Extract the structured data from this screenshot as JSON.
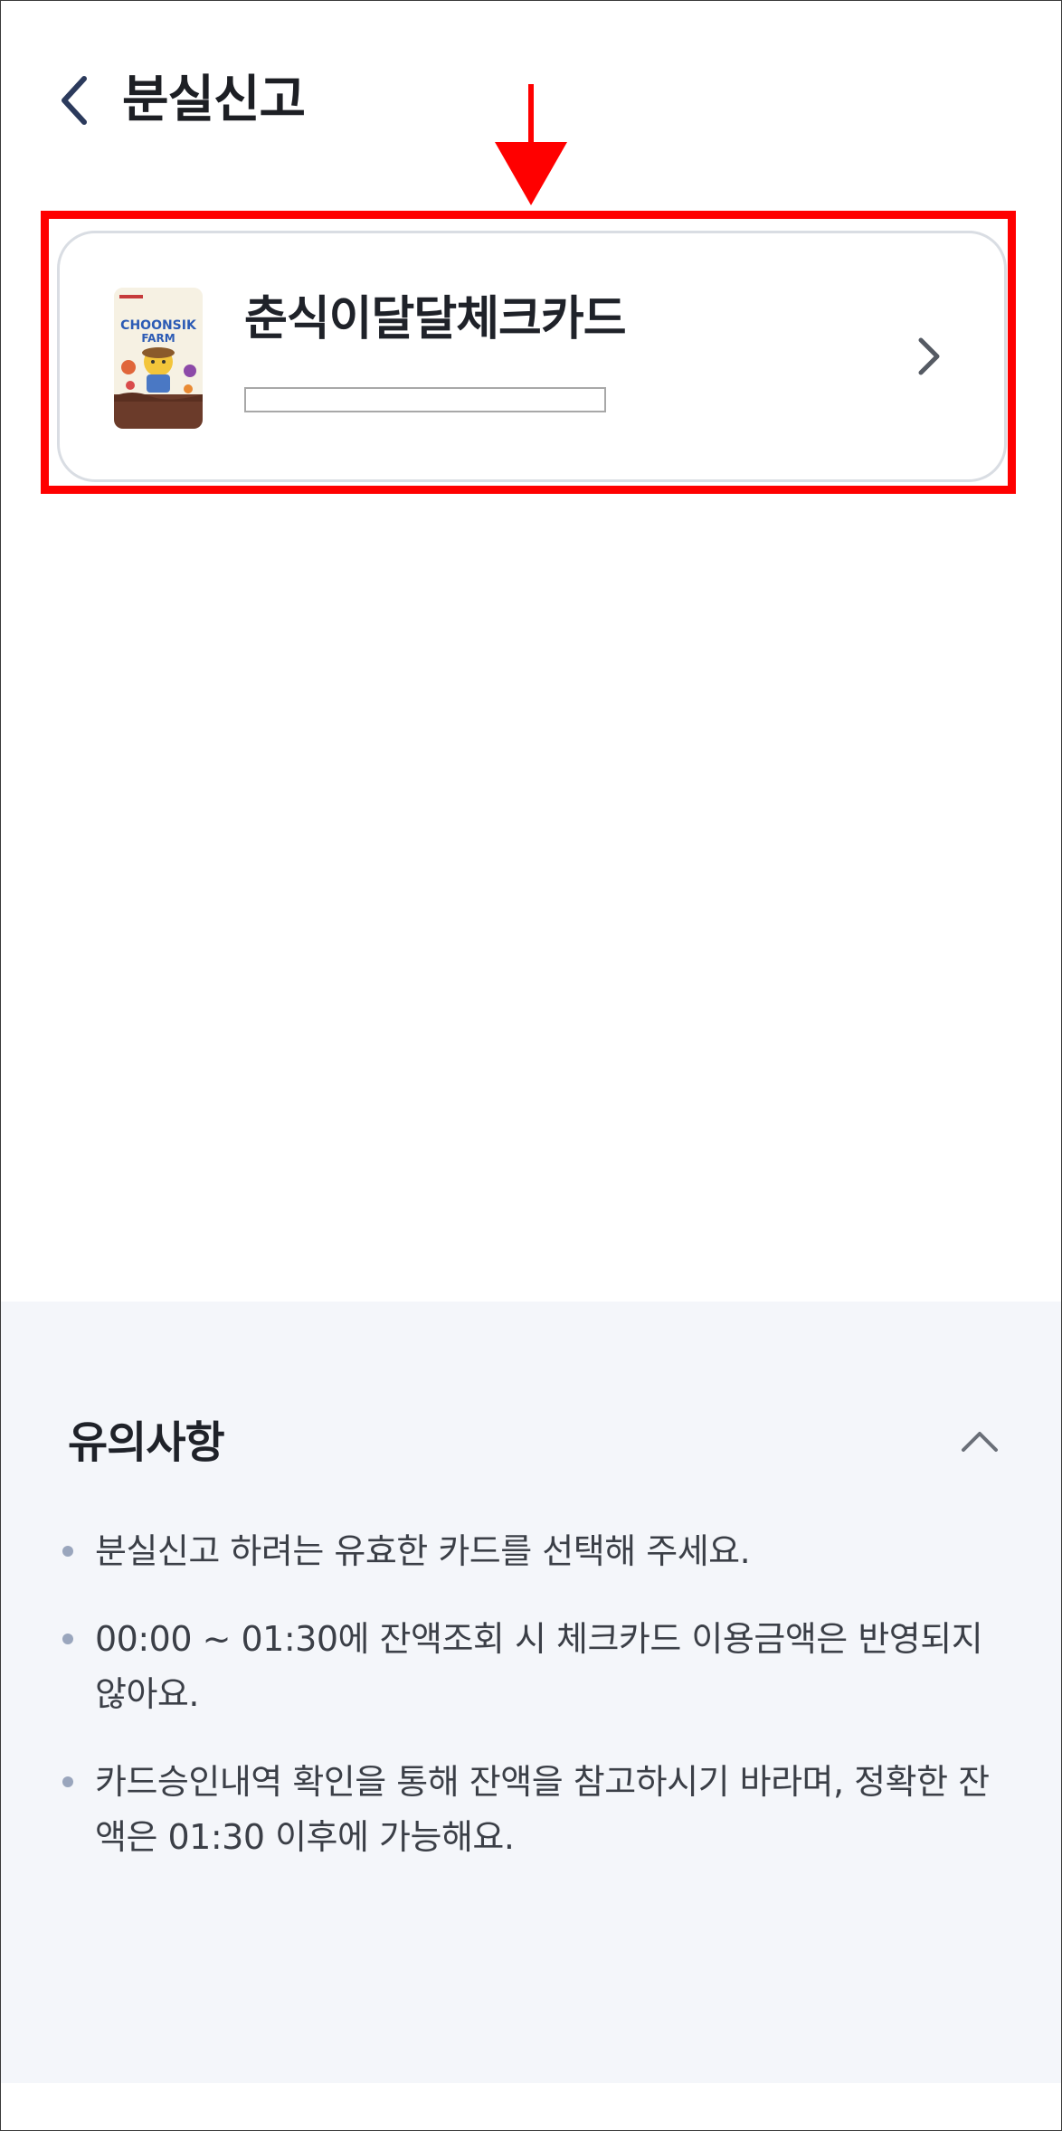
{
  "header": {
    "title": "분실신고",
    "back_icon": "chevron-left-icon"
  },
  "annotation": {
    "arrow_color": "#ff0000",
    "highlight_color": "#ff0000"
  },
  "card": {
    "name": "춘식이달달체크카드",
    "number": "",
    "thumb_icon": "card-image-icon",
    "chevron_icon": "chevron-right-icon"
  },
  "notice": {
    "title": "유의사항",
    "collapse_icon": "chevron-up-icon",
    "items": [
      "분실신고 하려는 유효한 카드를 선택해 주세요.",
      "00:00 ~ 01:30에 잔액조회 시 체크카드 이용금액은 반영되지 않아요.",
      "카드승인내역 확인을 통해 잔액을 참고하시기 바라며, 정확한 잔액은 01:30 이후에 가능해요."
    ],
    "bg_color": "#f4f6fa"
  }
}
